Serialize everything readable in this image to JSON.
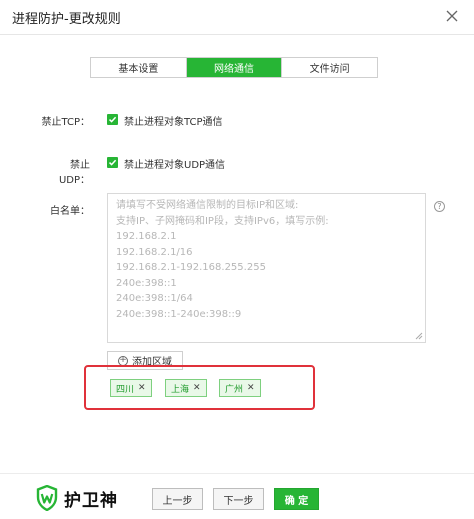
{
  "window": {
    "title": "进程防护-更改规则"
  },
  "tabs": [
    {
      "label": "基本设置",
      "active": false
    },
    {
      "label": "网络通信",
      "active": true
    },
    {
      "label": "文件访问",
      "active": false
    }
  ],
  "tcp": {
    "label": "禁止TCP：",
    "checkbox_text": "禁止进程对象TCP通信",
    "checked": true
  },
  "udp": {
    "label": "禁止UDP：",
    "checkbox_text": "禁止进程对象UDP通信",
    "checked": true
  },
  "whitelist": {
    "label": "白名单：",
    "placeholder_lines": [
      "请填写不受网络通信限制的目标IP和区域:",
      "支持IP、子网掩码和IP段，支持IPv6，填写示例:",
      "192.168.2.1",
      "192.168.2.1/16",
      "192.168.2.1-192.168.255.255",
      "240e:398::1",
      "240e:398::1/64",
      "240e:398::1-240e:398::9"
    ],
    "add_region_label": "添加区域",
    "regions": [
      "四川",
      "上海",
      "广州"
    ]
  },
  "footer": {
    "brand": "护卫神",
    "prev_label": "上一步",
    "next_label": "下一步",
    "ok_label": "确 定"
  },
  "colors": {
    "accent": "#27b535",
    "highlight": "#e0313a",
    "tag_bg": "#e9f8e8"
  }
}
